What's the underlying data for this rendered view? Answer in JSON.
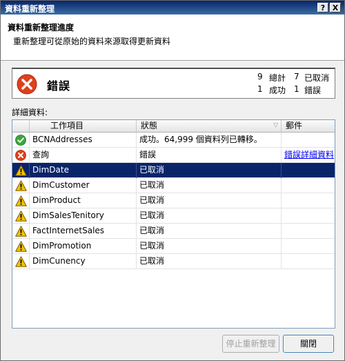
{
  "window": {
    "title": "資料重新整理",
    "help_button": "?",
    "close_button": "X"
  },
  "header": {
    "title": "資料重新整理進度",
    "subtitle": "重新整理可從原始的資料來源取得更新資料"
  },
  "status": {
    "label": "錯誤",
    "total_count": "9",
    "total_label": "總計",
    "cancelled_count": "7",
    "cancelled_label": "已取消",
    "success_count": "1",
    "success_label": "成功",
    "error_count": "1",
    "error_label": "錯誤"
  },
  "details_label": "詳細資料:",
  "table": {
    "columns": [
      "工作項目",
      "狀態",
      "郵件"
    ],
    "rows": [
      {
        "icon": "success-icon",
        "item": "BCNAddresses",
        "status": "成功。64,999 個資料列已轉移。",
        "message": ""
      },
      {
        "icon": "error-icon",
        "item": "查詢",
        "status": "錯誤",
        "message": "錯誤詳細資料"
      },
      {
        "icon": "warning-icon",
        "item": "DimDate",
        "status": "已取消",
        "message": ""
      },
      {
        "icon": "warning-icon",
        "item": "DimCustomer",
        "status": "已取消",
        "message": ""
      },
      {
        "icon": "warning-icon",
        "item": "DimProduct",
        "status": "已取消",
        "message": ""
      },
      {
        "icon": "warning-icon",
        "item": "DimSalesTenitory",
        "status": "已取消",
        "message": ""
      },
      {
        "icon": "warning-icon",
        "item": "FactInternetSales",
        "status": "已取消",
        "message": ""
      },
      {
        "icon": "warning-icon",
        "item": "DimPromotion",
        "status": "已取消",
        "message": ""
      },
      {
        "icon": "warning-icon",
        "item": "DimCunency",
        "status": "已取消",
        "message": ""
      }
    ],
    "selected_row": 2
  },
  "buttons": {
    "stop": "停止重新整理",
    "close": "關閉"
  },
  "colors": {
    "title_bar": "#0a246a",
    "selection": "#0a246a",
    "error": "#e0401c",
    "success": "#3aa63a",
    "warning": "#f2c200"
  }
}
